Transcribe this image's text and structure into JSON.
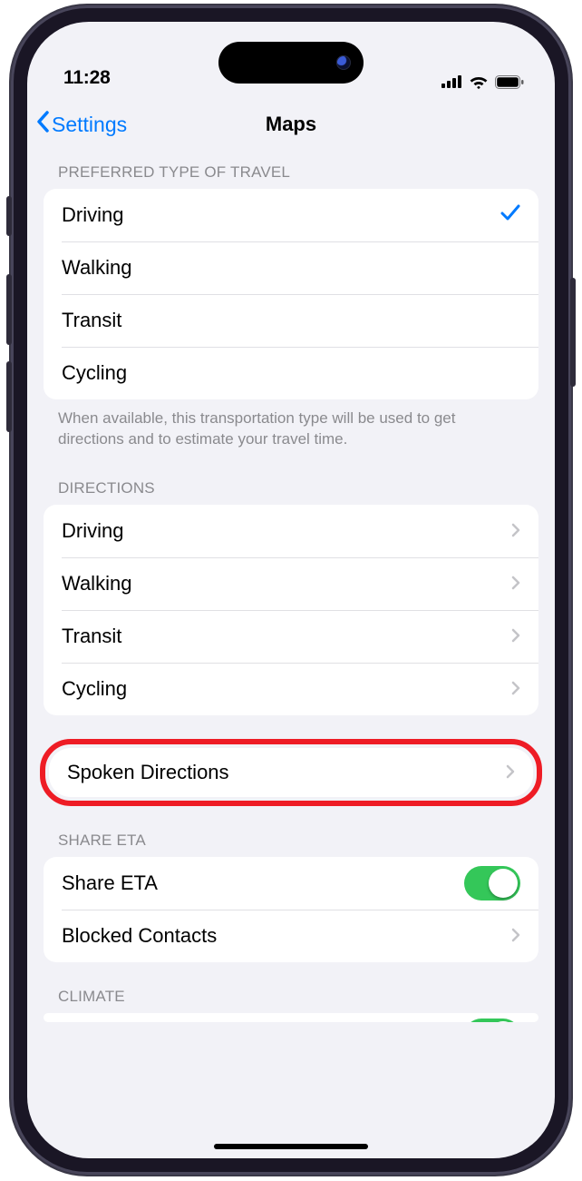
{
  "status": {
    "time": "11:28"
  },
  "nav": {
    "back_label": "Settings",
    "title": "Maps"
  },
  "sections": {
    "preferred": {
      "header": "Preferred Type of Travel",
      "items": [
        {
          "label": "Driving",
          "selected": true
        },
        {
          "label": "Walking",
          "selected": false
        },
        {
          "label": "Transit",
          "selected": false
        },
        {
          "label": "Cycling",
          "selected": false
        }
      ],
      "footer": "When available, this transportation type will be used to get directions and to estimate your travel time."
    },
    "directions": {
      "header": "Directions",
      "items": [
        {
          "label": "Driving"
        },
        {
          "label": "Walking"
        },
        {
          "label": "Transit"
        },
        {
          "label": "Cycling"
        }
      ]
    },
    "spoken": {
      "label": "Spoken Directions"
    },
    "share_eta": {
      "header": "Share ETA",
      "items": {
        "share": {
          "label": "Share ETA",
          "on": true
        },
        "blocked": {
          "label": "Blocked Contacts"
        }
      }
    },
    "climate": {
      "header": "Climate"
    }
  }
}
